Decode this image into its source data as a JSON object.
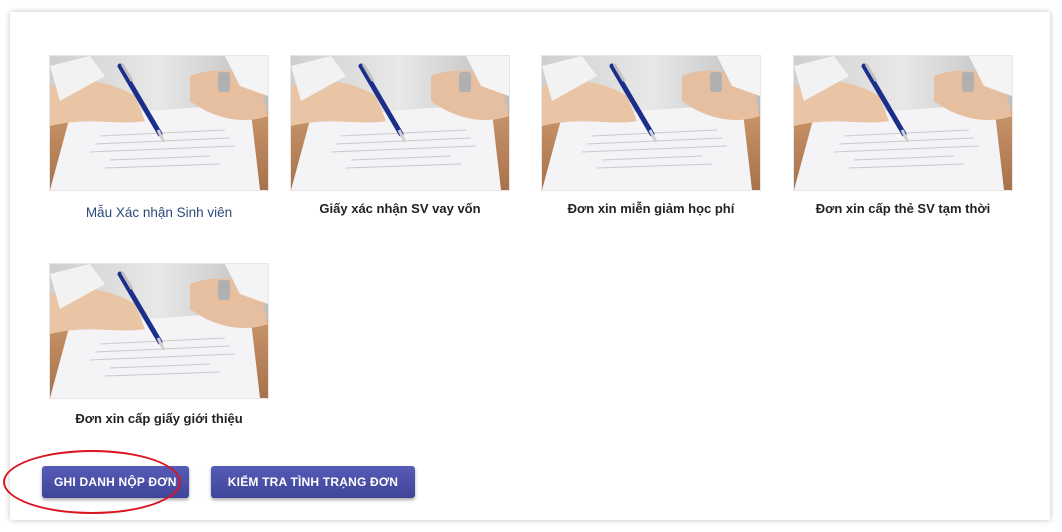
{
  "forms": [
    {
      "label": "Mẫu Xác nhận Sinh viên"
    },
    {
      "label": "Giấy xác nhận SV vay vốn"
    },
    {
      "label": "Đơn xin miễn giảm học phí"
    },
    {
      "label": "Đơn xin cấp thẻ SV tạm thời"
    },
    {
      "label": "Đơn xin cấp giấy giới thiệu"
    }
  ],
  "buttons": {
    "register": "GHI DANH NỘP ĐƠN",
    "check_status": "KIỂM TRA TÌNH TRẠNG ĐƠN"
  },
  "colors": {
    "button": "#4b50a8",
    "link_caption": "#2c4a7a",
    "annotation": "#d9141f"
  }
}
